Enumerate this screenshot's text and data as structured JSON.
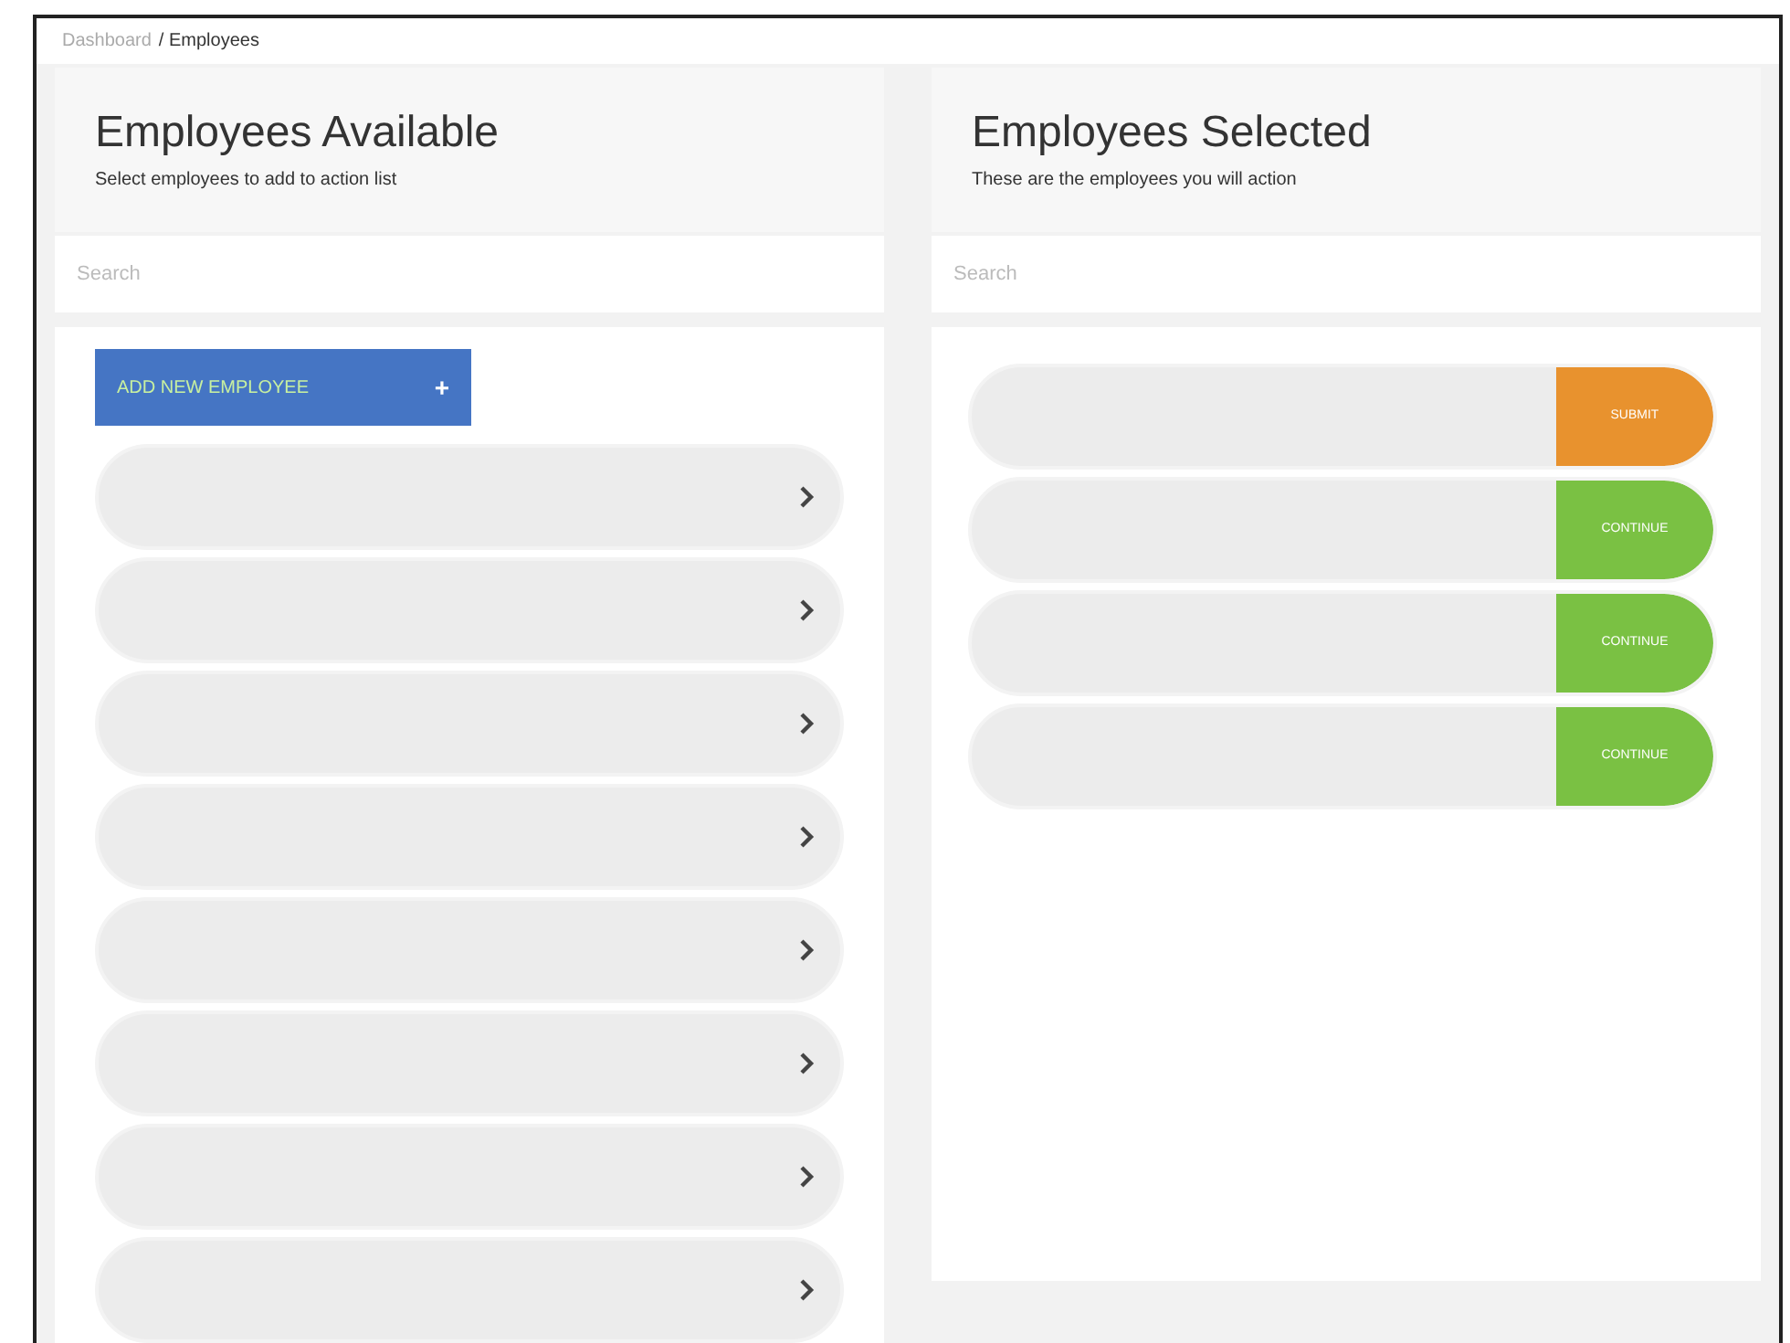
{
  "breadcrumb": [
    {
      "label": "Dashboard",
      "current": false
    },
    {
      "label": "/ Employees",
      "current": true
    }
  ],
  "available": {
    "title": "Employees Available",
    "subtitle": "Select employees to add to action list",
    "search": {
      "placeholder": "Search"
    },
    "add_button": {
      "label": "ADD NEW EMPLOYEE",
      "icon": "+"
    },
    "rows": [
      {
        "kind": "employee"
      },
      {
        "kind": "employee"
      },
      {
        "kind": "employee"
      },
      {
        "kind": "employee"
      },
      {
        "kind": "employee"
      },
      {
        "kind": "employee"
      },
      {
        "kind": "employee"
      },
      {
        "kind": "employee"
      }
    ]
  },
  "selected": {
    "title": "Employees Selected",
    "subtitle": "These are the employees you will action",
    "search": {
      "placeholder": "Search"
    },
    "rows": [
      {
        "kind": "submit",
        "action": "SUBMIT"
      },
      {
        "kind": "continue",
        "action": "CONTINUE"
      },
      {
        "kind": "continue",
        "action": "CONTINUE"
      },
      {
        "kind": "continue",
        "action": "CONTINUE"
      }
    ]
  }
}
